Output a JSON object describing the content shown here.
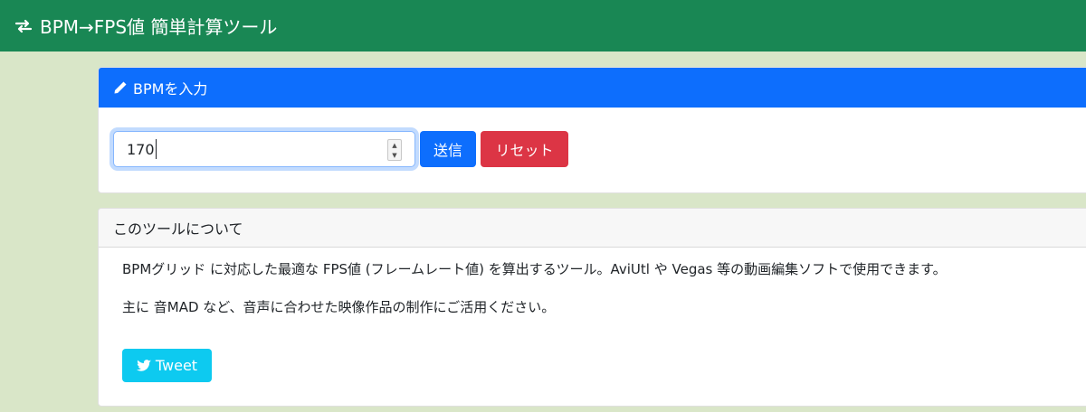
{
  "navbar": {
    "icon": "exchange-arrows-icon",
    "title": "BPM→FPS値 簡単計算ツール",
    "bg_color": "#198754"
  },
  "input_card": {
    "header_icon": "pencil-icon",
    "header_label": "BPMを入力",
    "header_color": "#0d6efd",
    "bpm_value": "170",
    "send_label": "送信",
    "reset_label": "リセット"
  },
  "about_card": {
    "header_label": "このツールについて",
    "paragraph1": "BPMグリッド に対応した最適な FPS値 (フレームレート値) を算出するツール。AviUtl や Vegas 等の動画編集ソフトで使用できます。",
    "paragraph2": "主に 音MAD など、音声に合わせた映像作品の制作にご活用ください。",
    "tweet_icon": "twitter-bird-icon",
    "tweet_label": "Tweet",
    "tweet_color": "#0dcaf0"
  }
}
